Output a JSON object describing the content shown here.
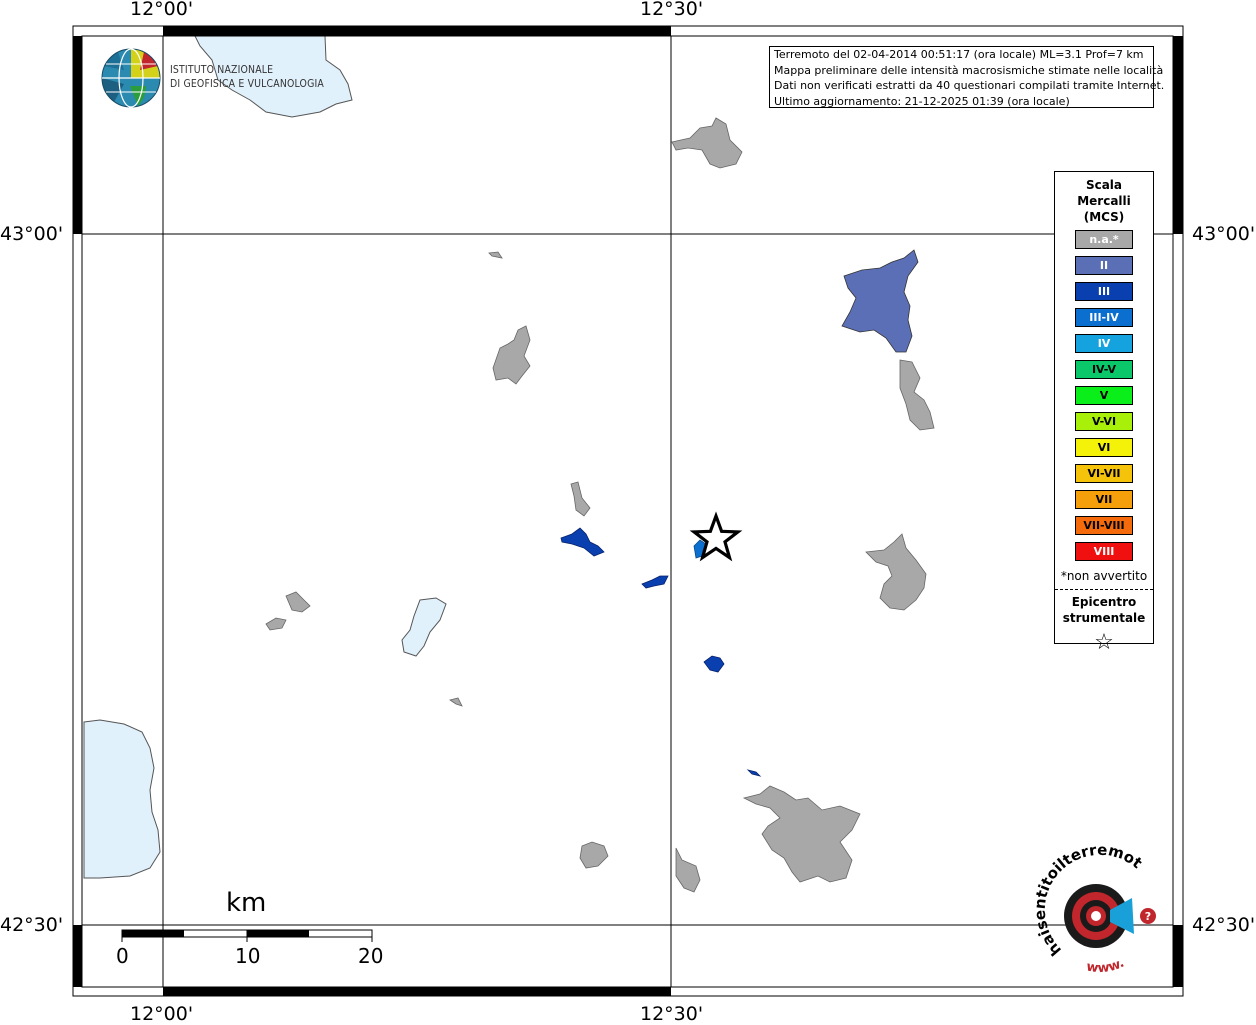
{
  "map": {
    "coords": {
      "lon_left": "12°00'",
      "lon_mid": "12°30'",
      "lat_top": "43°00'",
      "lat_bottom": "42°30'"
    },
    "logo": {
      "line1": "ISTITUTO NAZIONALE",
      "line2": "DI GEOFISICA E VULCANOLOGIA",
      "icon": "globe-icon"
    },
    "info": {
      "line1": "Terremoto del 02-04-2014 00:51:17 (ora locale) ML=3.1 Prof=7 km",
      "line2": "Mappa preliminare delle intensità macrosismiche stimate nelle località",
      "line3": "Dati non verificati estratti da 40 questionari compilati tramite Internet.",
      "line4": "Ultimo aggiornamento: 21-12-2025 01:39 (ora locale)"
    },
    "legend": {
      "title1": "Scala",
      "title2": "Mercalli",
      "title3": "(MCS)",
      "items": [
        {
          "label": "n.a.*",
          "color": "#a8a8a8",
          "text": "#ffffff"
        },
        {
          "label": "II",
          "color": "#5b6fb7",
          "text": "#ffffff"
        },
        {
          "label": "III",
          "color": "#0a3fb0",
          "text": "#ffffff"
        },
        {
          "label": "III-IV",
          "color": "#0b6fd0",
          "text": "#ffffff"
        },
        {
          "label": "IV",
          "color": "#15a3e0",
          "text": "#ffffff"
        },
        {
          "label": "IV-V",
          "color": "#0ac86a",
          "text": "#000000"
        },
        {
          "label": "V",
          "color": "#0aee1a",
          "text": "#000000"
        },
        {
          "label": "V-VI",
          "color": "#a8f00a",
          "text": "#000000"
        },
        {
          "label": "VI",
          "color": "#f5f20a",
          "text": "#000000"
        },
        {
          "label": "VI-VII",
          "color": "#f5c40a",
          "text": "#000000"
        },
        {
          "label": "VII",
          "color": "#f5a00a",
          "text": "#000000"
        },
        {
          "label": "VII-VIII",
          "color": "#f56a0a",
          "text": "#000000"
        },
        {
          "label": "VIII",
          "color": "#f01010",
          "text": "#ffffff"
        }
      ],
      "note": "*non avvertito",
      "epicenter1": "Epicentro",
      "epicenter2": "strumentale",
      "star_icon": "☆"
    },
    "scale": {
      "unit": "km",
      "labels": [
        "0",
        "10",
        "20"
      ]
    },
    "haisentito": {
      "text": "haisentitoilterremoto.it",
      "www": "www."
    }
  }
}
